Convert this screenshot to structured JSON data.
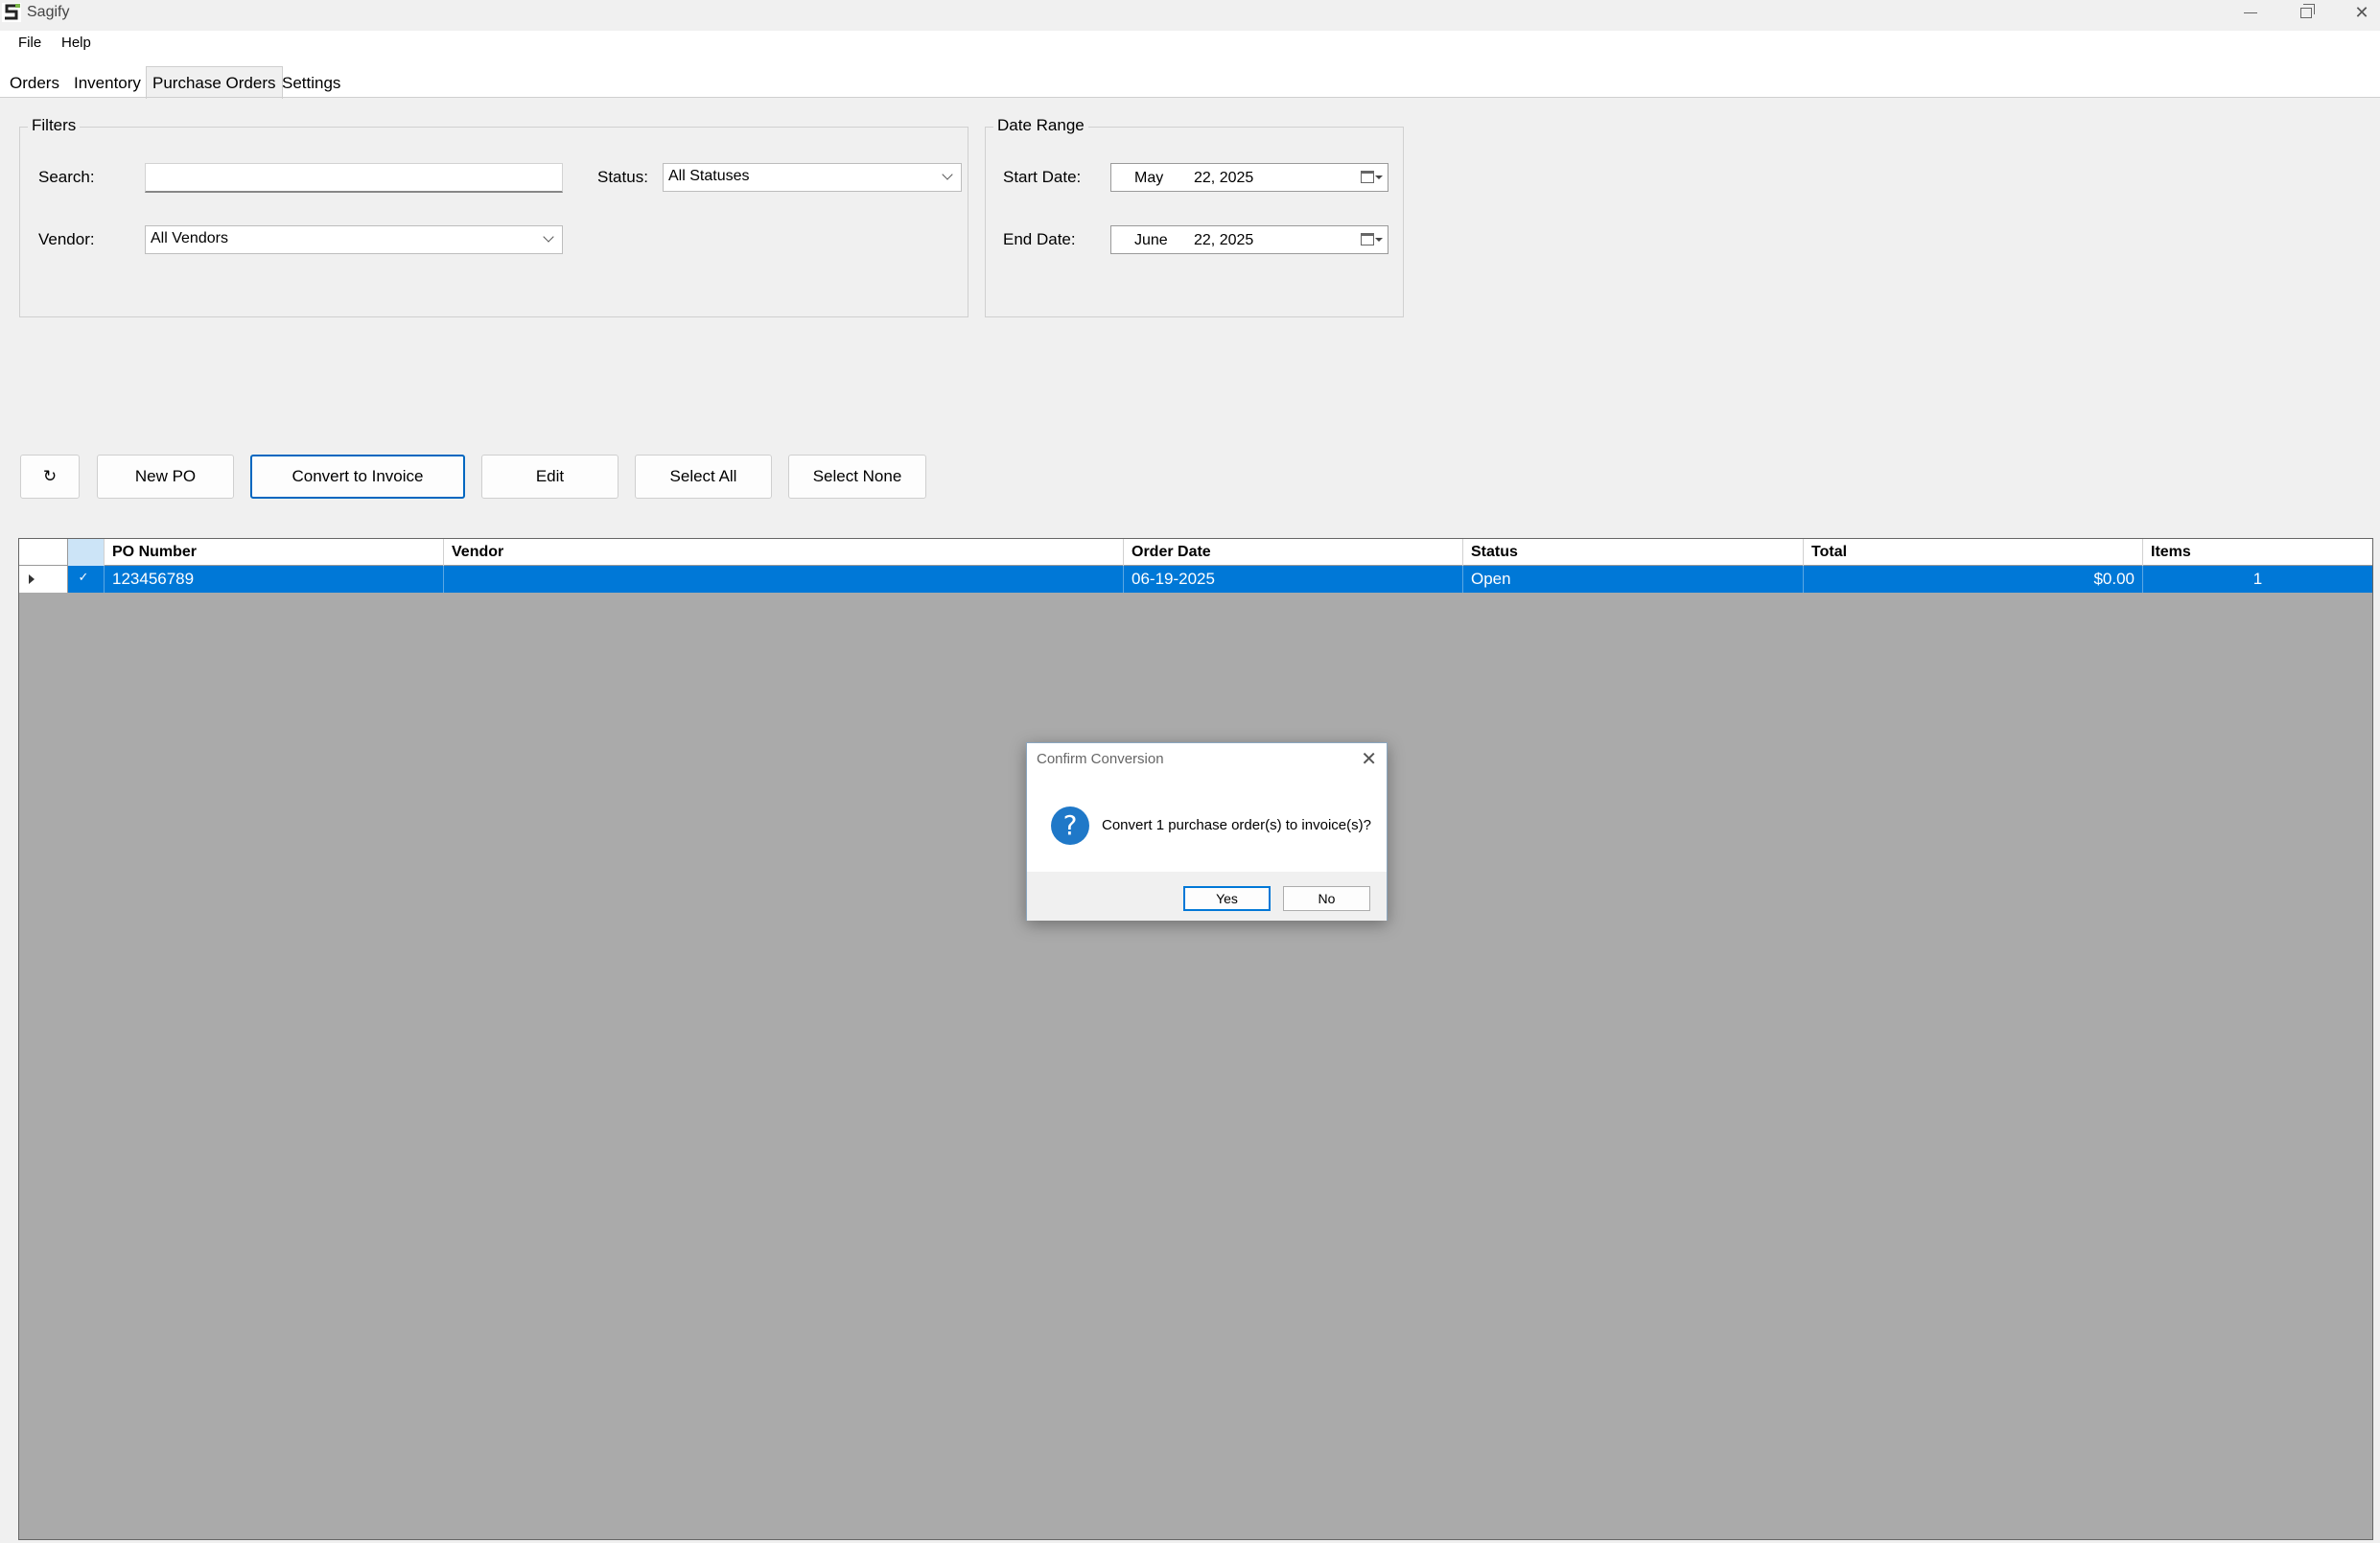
{
  "window": {
    "title": "Sagify"
  },
  "menu": {
    "file": "File",
    "help": "Help"
  },
  "tabs": [
    {
      "label": "Orders"
    },
    {
      "label": "Inventory"
    },
    {
      "label": "Purchase Orders"
    },
    {
      "label": "Settings"
    }
  ],
  "filters": {
    "legend": "Filters",
    "search_label": "Search:",
    "search_value": "",
    "status_label": "Status:",
    "status_value": "All Statuses",
    "vendor_label": "Vendor:",
    "vendor_value": "All Vendors"
  },
  "date_range": {
    "legend": "Date Range",
    "start_label": "Start Date:",
    "start_month": "May",
    "start_rest": "22, 2025",
    "end_label": "End Date:",
    "end_month": "June",
    "end_rest": "22, 2025"
  },
  "toolbar": {
    "refresh": "↻",
    "new_po": "New PO",
    "convert": "Convert to Invoice",
    "edit": "Edit",
    "select_all": "Select All",
    "select_none": "Select None"
  },
  "grid": {
    "columns": [
      "PO Number",
      "Vendor",
      "Order Date",
      "Status",
      "Total",
      "Items"
    ],
    "rows": [
      {
        "checked": "✓",
        "po_number": "123456789",
        "vendor": "",
        "order_date": "06-19-2025",
        "status": "Open",
        "total": "$0.00",
        "items": "1"
      }
    ]
  },
  "dialog": {
    "title": "Confirm Conversion",
    "close": "✕",
    "icon": "?",
    "message": "Convert 1 purchase order(s) to invoice(s)?",
    "yes": "Yes",
    "no": "No"
  },
  "colors": {
    "selection": "#0078d7",
    "accent": "#0067c0",
    "grid_bg": "#aaaaaa"
  }
}
